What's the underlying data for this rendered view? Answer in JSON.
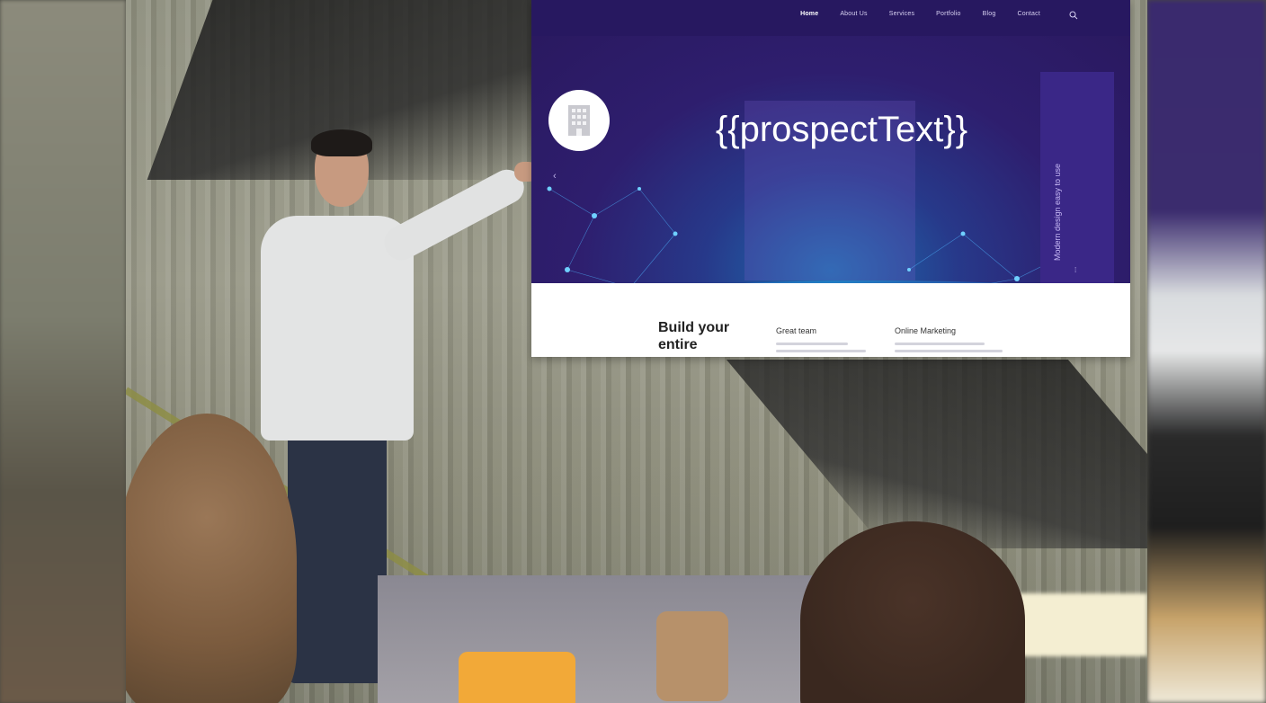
{
  "screen": {
    "nav": [
      "Home",
      "About Us",
      "Services",
      "Portfolio",
      "Blog",
      "Contact"
    ],
    "active_nav": "Home",
    "hero_title": "{{prospectText}}",
    "side_heading": "Modern design easy to use",
    "content_title": "Build your entire",
    "features": [
      "Great team",
      "Online Marketing"
    ]
  },
  "colors": {
    "screen_background": "#2c1b66",
    "hero_glow": "#1d6fb0",
    "content_background": "#ffffff"
  },
  "icons": [
    "building-icon",
    "search-icon",
    "chevron-left-icon",
    "dots-icon"
  ]
}
